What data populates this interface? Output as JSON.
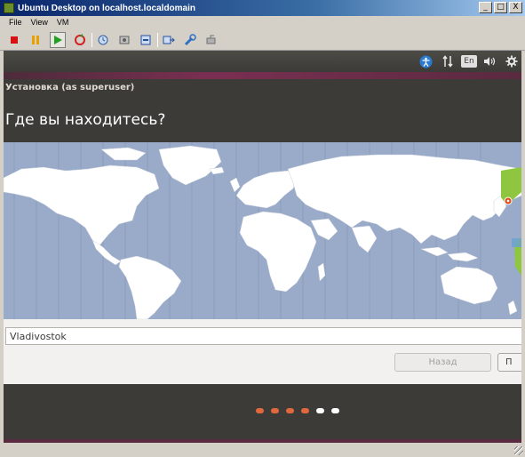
{
  "window": {
    "title": "Ubuntu Desktop on localhost.localdomain",
    "controls": [
      "_",
      "□",
      "X"
    ]
  },
  "menu": [
    "File",
    "View",
    "VM"
  ],
  "toolbar": {
    "icons": [
      "stop-icon",
      "pause-icon",
      "play-icon",
      "reset-icon",
      "snapshot-icon",
      "snapshot-manager-icon",
      "revert-icon",
      "send-keys-icon",
      "settings-icon",
      "devices-icon"
    ]
  },
  "panel": {
    "keyboard_layout": "En",
    "icons": [
      "accessibility-icon",
      "network-icon",
      "keyboard-layout-icon",
      "volume-icon",
      "settings-gear-icon"
    ]
  },
  "installer": {
    "title": "Установка (as superuser)",
    "heading": "Где вы находитесь?",
    "location_value": "Vladivostok",
    "back_label": "Назад",
    "next_label": "П"
  },
  "progress": {
    "total_steps": 6,
    "completed_steps": 4
  },
  "colors": {
    "ubuntu_orange": "#dd4814",
    "dot_done": "#e0683c",
    "dot_pending": "#ffffff",
    "map_sea": "#99abc9",
    "map_land": "#ffffff",
    "timezone_highlight": "#8ec640"
  }
}
